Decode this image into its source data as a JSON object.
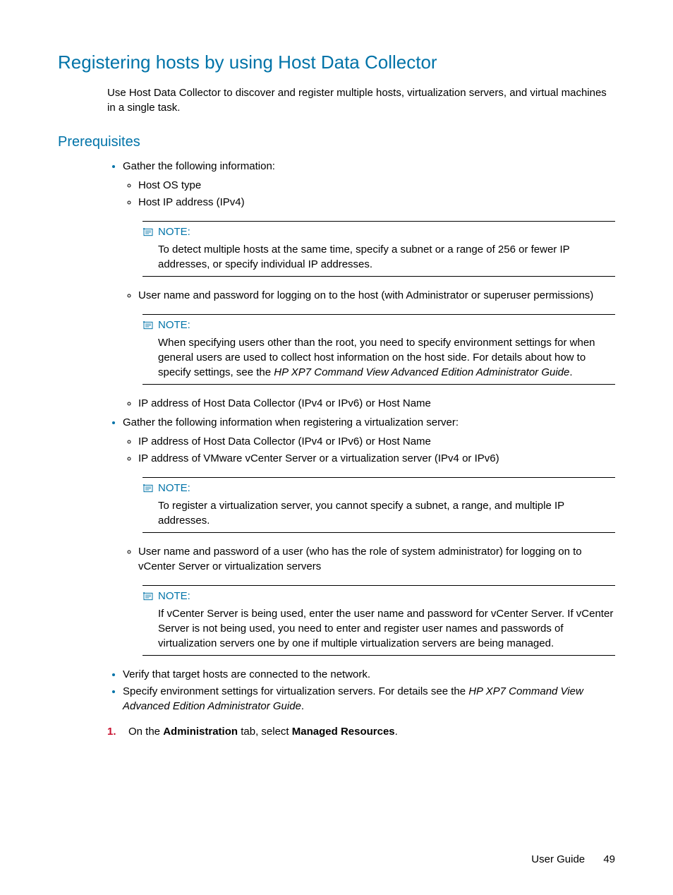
{
  "h1": "Registering hosts by using Host Data Collector",
  "intro": "Use Host Data Collector to discover and register multiple hosts, virtualization servers, and virtual machines in a single task.",
  "h2": "Prerequisites",
  "bullets": {
    "gather": "Gather the following information:",
    "hostOS": "Host OS type",
    "hostIP": "Host IP address (IPv4)",
    "userPwHost": "User name and password for logging on to the host (with Administrator or superuser permissions)",
    "ipHdc": "IP address of Host Data Collector (IPv4 or IPv6) or Host Name",
    "gatherVirt": "Gather the following information when registering a virtualization server:",
    "ipHdc2": "IP address of Host Data Collector (IPv4 or IPv6) or Host Name",
    "ipVmware": "IP address of VMware vCenter Server or a virtualization server (IPv4 or IPv6)",
    "userPwVc": "User name and password of a user (who has the role of system administrator) for logging on to vCenter Server or virtualization servers",
    "verify": "Verify that target hosts are connected to the network.",
    "envSettings1": "Specify environment settings for virtualization servers. For details see the ",
    "envSettings2": "HP XP7 Command View Advanced Edition Administrator Guide",
    "envSettings3": "."
  },
  "noteLabel": "NOTE:",
  "notes": {
    "n1": "To detect multiple hosts at the same time, specify a subnet or a range of 256 or fewer IP addresses, or specify individual IP addresses.",
    "n2a": "When specifying users other than the root, you need to specify environment settings for when general users are used to collect host information on the host side. For details about how to specify settings, see the ",
    "n2b": "HP XP7 Command View Advanced Edition Administrator Guide",
    "n2c": ".",
    "n3": "To register a virtualization server, you cannot specify a subnet, a range, and multiple IP addresses.",
    "n4": "If vCenter Server is being used, enter the user name and password for vCenter Server. If vCenter Server is not being used, you need to enter and register user names and passwords of virtualization servers one by one if multiple virtualization servers are being managed."
  },
  "step": {
    "num": "1.",
    "a": "On the ",
    "b": "Administration",
    "c": " tab, select ",
    "d": "Managed Resources",
    "e": "."
  },
  "footer": {
    "label": "User Guide",
    "page": "49"
  }
}
